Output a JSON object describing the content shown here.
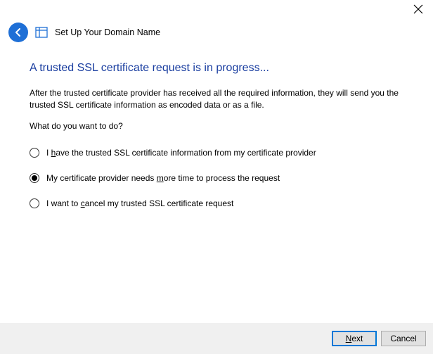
{
  "window": {
    "title": "Set Up Your Domain Name"
  },
  "main": {
    "heading": "A trusted SSL certificate request is in progress...",
    "description": "After the trusted certificate provider has received all the required information, they will send you the trusted SSL certificate information as encoded data or as a file.",
    "prompt": "What do you want to do?"
  },
  "options": [
    {
      "before": "I ",
      "accel": "h",
      "after": "ave the trusted SSL certificate information from my certificate provider",
      "selected": false
    },
    {
      "before": "My certificate provider needs ",
      "accel": "m",
      "after": "ore time to process the request",
      "selected": true
    },
    {
      "before": "I want to ",
      "accel": "c",
      "after": "ancel my trusted SSL certificate request",
      "selected": false
    }
  ],
  "footer": {
    "next_before": "",
    "next_accel": "N",
    "next_after": "ext",
    "cancel": "Cancel"
  }
}
